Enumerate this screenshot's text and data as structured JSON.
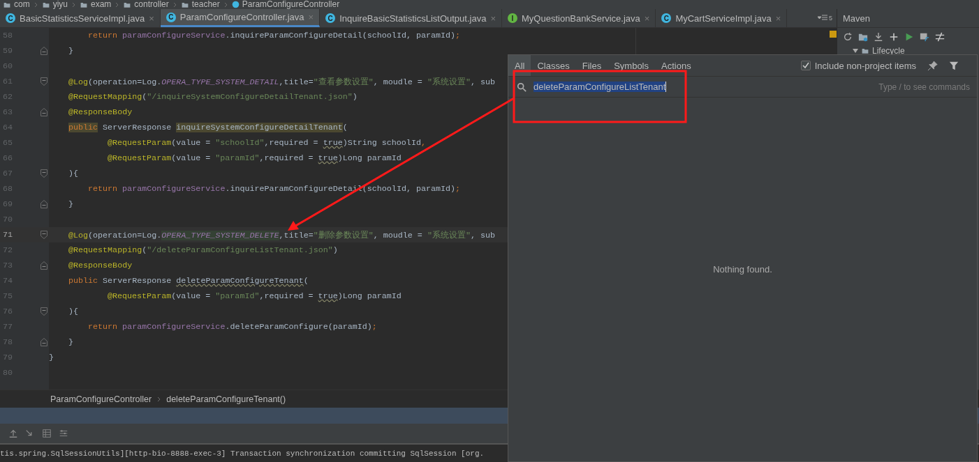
{
  "breadcrumb": [
    {
      "label": "com",
      "kind": "folder"
    },
    {
      "label": "yiyu",
      "kind": "folder"
    },
    {
      "label": "exam",
      "kind": "folder"
    },
    {
      "label": "controller",
      "kind": "folder"
    },
    {
      "label": "teacher",
      "kind": "folder"
    },
    {
      "label": "ParamConfigureController",
      "kind": "class"
    }
  ],
  "tabs": [
    {
      "label": "BasicStatisticsServiceImpl.java",
      "badge": "C",
      "kind": "class",
      "selected": false,
      "close": "×"
    },
    {
      "label": "ParamConfigureController.java",
      "badge": "C",
      "kind": "class",
      "selected": true,
      "close": "×"
    },
    {
      "label": "InquireBasicStatisticsListOutput.java",
      "badge": "C",
      "kind": "class",
      "selected": false,
      "close": "×"
    },
    {
      "label": "MyQuestionBankService.java",
      "badge": "I",
      "kind": "interface",
      "selected": false,
      "close": "×"
    },
    {
      "label": "MyCartServiceImpl.java",
      "badge": "C",
      "kind": "class",
      "selected": false,
      "close": "×"
    }
  ],
  "tab_overflow": {
    "count": "5"
  },
  "code_lines": [
    {
      "number": "58",
      "current": false,
      "kind": "statement",
      "tokens": [
        {
          "text": "return ",
          "kind": "kw"
        },
        {
          "text": "paramConfigureService",
          "kind": "field"
        },
        {
          "text": ".inquireParamConfigureDetail(schoolId, paramId)",
          "kind": "plain"
        },
        {
          "text": ";",
          "kind": "kw"
        }
      ]
    },
    {
      "number": "59",
      "current": false,
      "kind": "member",
      "fold_end": true,
      "tokens": [
        {
          "text": "}",
          "kind": "plain"
        }
      ]
    },
    {
      "number": "60",
      "current": false,
      "kind": "member"
    },
    {
      "number": "61",
      "current": false,
      "kind": "member",
      "fold_start": true,
      "tokens": [
        {
          "text": "@Log",
          "kind": "ann"
        },
        {
          "text": "(operation=Log.",
          "kind": "plain"
        },
        {
          "text": "OPERA_TYPE_SYSTEM_DETAIL",
          "kind": "const"
        },
        {
          "text": ",title=",
          "kind": "plain"
        },
        {
          "text": "\"查看参数设置\"",
          "kind": "str"
        },
        {
          "text": ", moudle = ",
          "kind": "plain"
        },
        {
          "text": "\"系统设置\"",
          "kind": "str"
        },
        {
          "text": ", sub",
          "kind": "plain"
        }
      ]
    },
    {
      "number": "62",
      "current": false,
      "kind": "member",
      "tokens": [
        {
          "text": "@RequestMapping",
          "kind": "ann"
        },
        {
          "text": "(",
          "kind": "plain"
        },
        {
          "text": "\"/inquireSystemConfigureDetailTenant.json\"",
          "kind": "str"
        },
        {
          "text": ")",
          "kind": "plain"
        }
      ]
    },
    {
      "number": "63",
      "current": false,
      "kind": "member",
      "fold_end": true,
      "tokens": [
        {
          "text": "@ResponseBody",
          "kind": "ann"
        }
      ]
    },
    {
      "number": "64",
      "current": false,
      "kind": "member",
      "tokens": [
        {
          "text": "public",
          "kind": "kw",
          "highlighted": true
        },
        {
          "text": " ServerResponse ",
          "kind": "plain"
        },
        {
          "text": "inquireSystemConfigureDetailTenant",
          "kind": "plain",
          "highlighted": true
        },
        {
          "text": "(",
          "kind": "plain"
        }
      ]
    },
    {
      "number": "65",
      "current": false,
      "kind": "param",
      "tokens": [
        {
          "text": "@RequestParam",
          "kind": "ann"
        },
        {
          "text": "(value = ",
          "kind": "plain"
        },
        {
          "text": "\"schoolId\"",
          "kind": "str"
        },
        {
          "text": ",required = ",
          "kind": "plain"
        },
        {
          "text": "true",
          "kind": "plain",
          "underlined": true
        },
        {
          "text": ")String schoolId",
          "kind": "plain"
        },
        {
          "text": ",",
          "kind": "kw"
        }
      ]
    },
    {
      "number": "66",
      "current": false,
      "kind": "param",
      "tokens": [
        {
          "text": "@RequestParam",
          "kind": "ann"
        },
        {
          "text": "(value = ",
          "kind": "plain"
        },
        {
          "text": "\"paramId\"",
          "kind": "str"
        },
        {
          "text": ",required = ",
          "kind": "plain"
        },
        {
          "text": "true",
          "kind": "plain",
          "underlined": true
        },
        {
          "text": ")Long paramId",
          "kind": "plain"
        }
      ]
    },
    {
      "number": "67",
      "current": false,
      "kind": "member",
      "fold_start": true,
      "tokens": [
        {
          "text": "){",
          "kind": "plain"
        }
      ]
    },
    {
      "number": "68",
      "current": false,
      "kind": "statement",
      "tokens": [
        {
          "text": "return ",
          "kind": "kw"
        },
        {
          "text": "paramConfigureService",
          "kind": "field"
        },
        {
          "text": ".inquireParamConfigureDetail(schoolId, paramId)",
          "kind": "plain"
        },
        {
          "text": ";",
          "kind": "kw"
        }
      ]
    },
    {
      "number": "69",
      "current": false,
      "kind": "member",
      "fold_end": true,
      "tokens": [
        {
          "text": "}",
          "kind": "plain"
        }
      ]
    },
    {
      "number": "70",
      "current": false,
      "kind": "member"
    },
    {
      "number": "71",
      "current": true,
      "kind": "member",
      "fold_start": true,
      "tokens": [
        {
          "text": "@Log",
          "kind": "ann"
        },
        {
          "text": "(operation=Log.",
          "kind": "plain"
        },
        {
          "text": "OPERA_TYPE_SYSTEM_DELETE",
          "kind": "const",
          "highlighted": true
        },
        {
          "text": ",title=",
          "kind": "plain"
        },
        {
          "text": "\"删除参数设置\"",
          "kind": "str"
        },
        {
          "text": ", moudle = ",
          "kind": "plain"
        },
        {
          "text": "\"系统设置\"",
          "kind": "str"
        },
        {
          "text": ", sub",
          "kind": "plain"
        }
      ]
    },
    {
      "number": "72",
      "current": false,
      "kind": "member",
      "tokens": [
        {
          "text": "@RequestMapping",
          "kind": "ann"
        },
        {
          "text": "(",
          "kind": "plain"
        },
        {
          "text": "\"/deleteParamConfigureListTenant.json\"",
          "kind": "str"
        },
        {
          "text": ")",
          "kind": "plain"
        }
      ]
    },
    {
      "number": "73",
      "current": false,
      "kind": "member",
      "fold_end": true,
      "tokens": [
        {
          "text": "@ResponseBody",
          "kind": "ann"
        }
      ]
    },
    {
      "number": "74",
      "current": false,
      "kind": "member",
      "tokens": [
        {
          "text": "public",
          "kind": "kw"
        },
        {
          "text": " ServerResponse ",
          "kind": "plain"
        },
        {
          "text": "deleteParamConfigureTenant",
          "kind": "plain",
          "underlined": true
        },
        {
          "text": "(",
          "kind": "plain"
        }
      ]
    },
    {
      "number": "75",
      "current": false,
      "kind": "param",
      "tokens": [
        {
          "text": "@RequestParam",
          "kind": "ann"
        },
        {
          "text": "(value = ",
          "kind": "plain"
        },
        {
          "text": "\"paramId\"",
          "kind": "str"
        },
        {
          "text": ",required = ",
          "kind": "plain"
        },
        {
          "text": "true",
          "kind": "plain",
          "underlined": true
        },
        {
          "text": ")Long paramId",
          "kind": "plain"
        }
      ]
    },
    {
      "number": "76",
      "current": false,
      "kind": "member",
      "fold_start": true,
      "tokens": [
        {
          "text": "){",
          "kind": "plain"
        }
      ]
    },
    {
      "number": "77",
      "current": false,
      "kind": "statement",
      "tokens": [
        {
          "text": "return ",
          "kind": "kw"
        },
        {
          "text": "paramConfigureService",
          "kind": "field"
        },
        {
          "text": ".deleteParamConfigure(paramId)",
          "kind": "plain"
        },
        {
          "text": ";",
          "kind": "kw"
        }
      ]
    },
    {
      "number": "78",
      "current": false,
      "kind": "member",
      "fold_end": true,
      "tokens": [
        {
          "text": "}",
          "kind": "plain"
        }
      ]
    },
    {
      "number": "79",
      "current": false,
      "kind": "top",
      "tokens": [
        {
          "text": "}",
          "kind": "plain"
        }
      ]
    },
    {
      "number": "80",
      "current": false,
      "kind": "top"
    }
  ],
  "editor_breadcrumb": [
    "ParamConfigureController",
    "deleteParamConfigureTenant()"
  ],
  "console_line": "tis.spring.SqlSessionUtils][http-bio-8888-exec-3] Transaction synchronization committing SqlSession [org.",
  "maven": {
    "title": "Maven",
    "tree": [
      {
        "label": "Lifecycle",
        "expanded": true
      }
    ]
  },
  "search_popup": {
    "tabs": [
      {
        "label": "All",
        "selected": true
      },
      {
        "label": "Classes",
        "selected": false
      },
      {
        "label": "Files",
        "selected": false
      },
      {
        "label": "Symbols",
        "selected": false
      },
      {
        "label": "Actions",
        "selected": false
      }
    ],
    "include_non_project": {
      "label": "Include non-project items",
      "checked": true
    },
    "query": "deleteParamConfigureListTenant",
    "query_selected": true,
    "hint": "Type / to see commands",
    "empty_message": "Nothing found."
  }
}
